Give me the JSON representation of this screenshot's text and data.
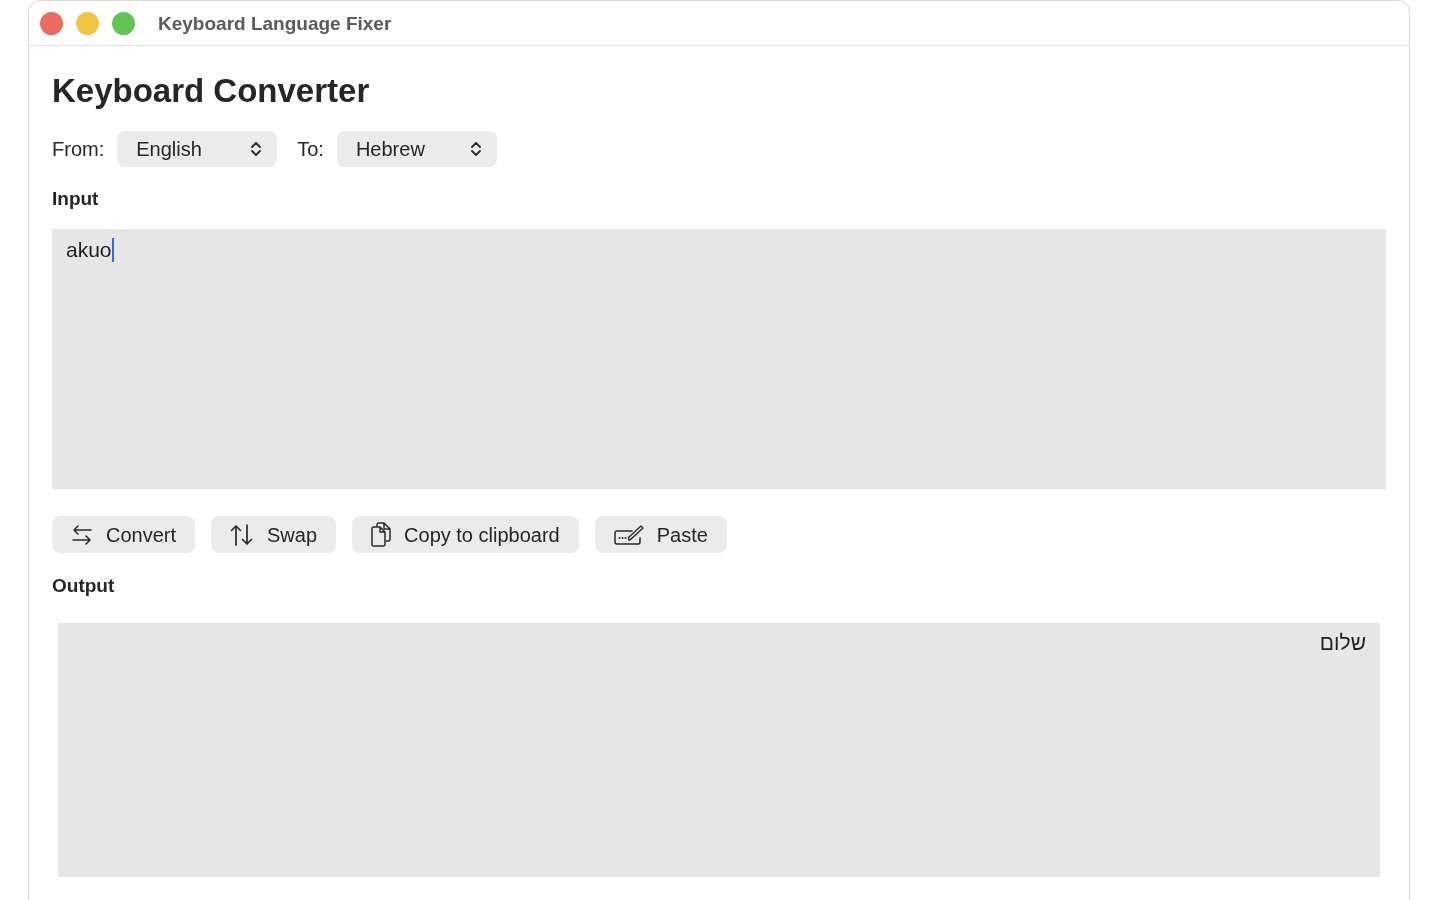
{
  "window": {
    "title": "Keyboard Language Fixer"
  },
  "heading": "Keyboard Converter",
  "selectors": [
    {
      "label": "From:",
      "value": "English"
    },
    {
      "label": "To:",
      "value": "Hebrew"
    }
  ],
  "input": {
    "label": "Input",
    "value": "akuo",
    "focused": true
  },
  "buttons": [
    {
      "kind": "convert",
      "label": "Convert"
    },
    {
      "kind": "swap",
      "label": "Swap"
    },
    {
      "kind": "copy",
      "label": "Copy to clipboard"
    },
    {
      "kind": "paste",
      "label": "Paste"
    }
  ],
  "output": {
    "label": "Output",
    "value": "שלום"
  }
}
